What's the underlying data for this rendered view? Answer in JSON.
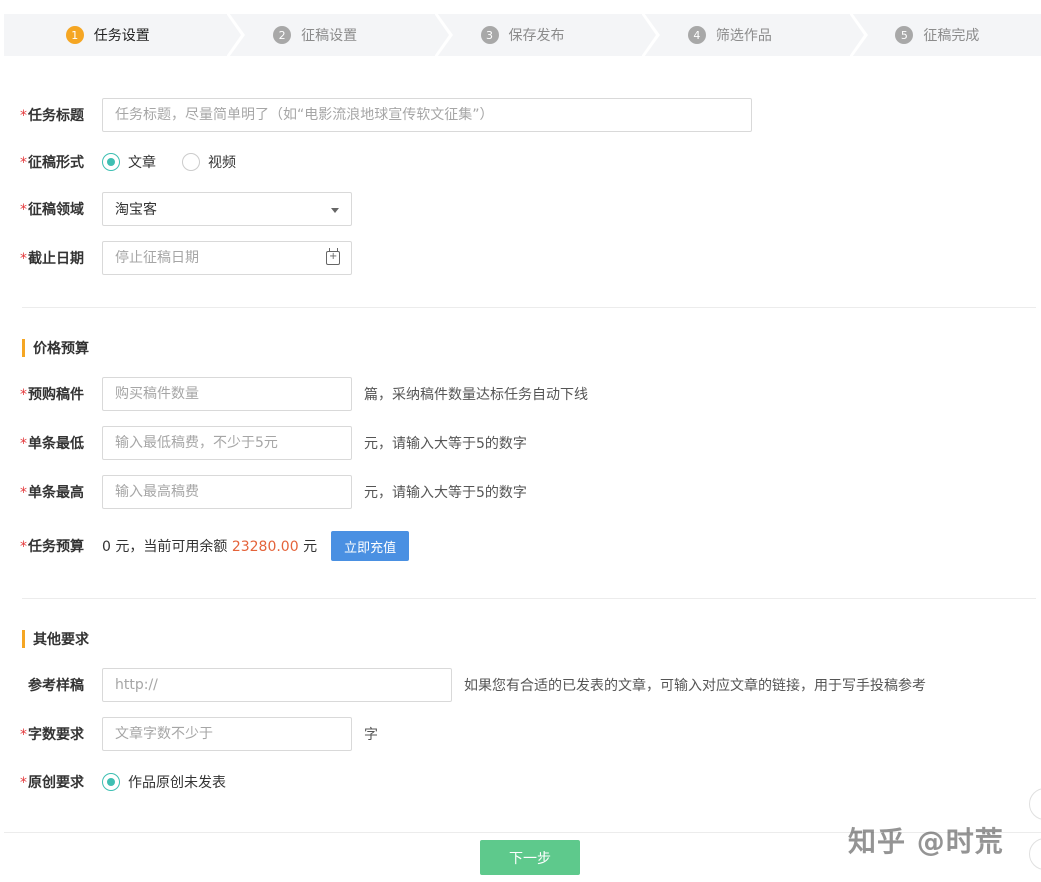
{
  "steps": [
    {
      "num": "1",
      "label": "任务设置"
    },
    {
      "num": "2",
      "label": "征稿设置"
    },
    {
      "num": "3",
      "label": "保存发布"
    },
    {
      "num": "4",
      "label": "筛选作品"
    },
    {
      "num": "5",
      "label": "征稿完成"
    }
  ],
  "basic": {
    "title_label": "任务标题",
    "title_placeholder": "任务标题，尽量简单明了（如“电影流浪地球宣传软文征集”）",
    "form_label": "征稿形式",
    "form_options": [
      "文章",
      "视频"
    ],
    "domain_label": "征稿领域",
    "domain_value": "淘宝客",
    "deadline_label": "截止日期",
    "deadline_placeholder": "停止征稿日期"
  },
  "price": {
    "section_title": "价格预算",
    "count_label": "预购稿件",
    "count_placeholder": "购买稿件数量",
    "count_hint": "篇，采纳稿件数量达标任务自动下线",
    "min_label": "单条最低",
    "min_placeholder": "输入最低稿费，不少于5元",
    "min_hint": "元，请输入大等于5的数字",
    "max_label": "单条最高",
    "max_placeholder": "输入最高稿费",
    "max_hint": "元，请输入大等于5的数字",
    "budget_label": "任务预算",
    "budget_prefix": "0 元，当前可用余额",
    "budget_amount": "23280.00",
    "budget_suffix": "元",
    "recharge_button": "立即充值"
  },
  "other": {
    "section_title": "其他要求",
    "sample_label": "参考样稿",
    "sample_value": "http://",
    "sample_hint": "如果您有合适的已发表的文章，可输入对应文章的链接，用于写手投稿参考",
    "words_label": "字数要求",
    "words_placeholder": "文章字数不少于",
    "words_hint": "字",
    "original_label": "原创要求",
    "original_option": "作品原创未发表"
  },
  "required_mark": "*",
  "next_button": "下一步",
  "watermark": "知乎 @时荒",
  "colors": {
    "accent_orange": "#f5a623",
    "radio_teal": "#3ebfb2",
    "recharge_blue": "#4a90e2",
    "next_green": "#5ec98c",
    "amount_red": "#e4633a"
  }
}
